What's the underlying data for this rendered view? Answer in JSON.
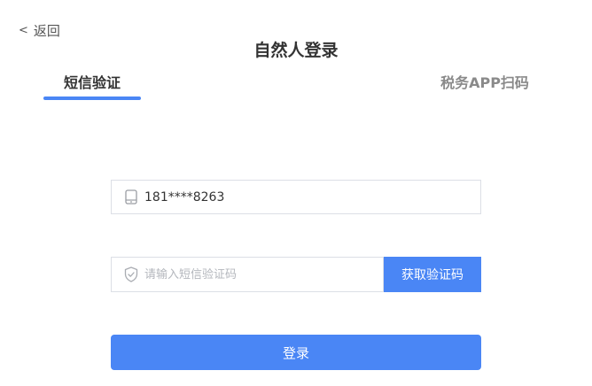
{
  "header": {
    "back_label": "返回",
    "back_chevron": "<",
    "title": "自然人登录"
  },
  "tabs": [
    {
      "label": "短信验证",
      "active": true
    },
    {
      "label": "税务APP扫码",
      "active": false
    }
  ],
  "form": {
    "phone": {
      "icon": "mobile-phone-icon",
      "value": "181****8263"
    },
    "code": {
      "icon": "shield-check-icon",
      "placeholder": "请输入短信验证码",
      "value": ""
    },
    "get_code_label": "获取验证码",
    "login_label": "登录"
  },
  "colors": {
    "accent": "#4a86f5",
    "border": "#dcdfe6",
    "inactive_tab": "#8a8a8a",
    "placeholder": "#b4b7bd"
  }
}
